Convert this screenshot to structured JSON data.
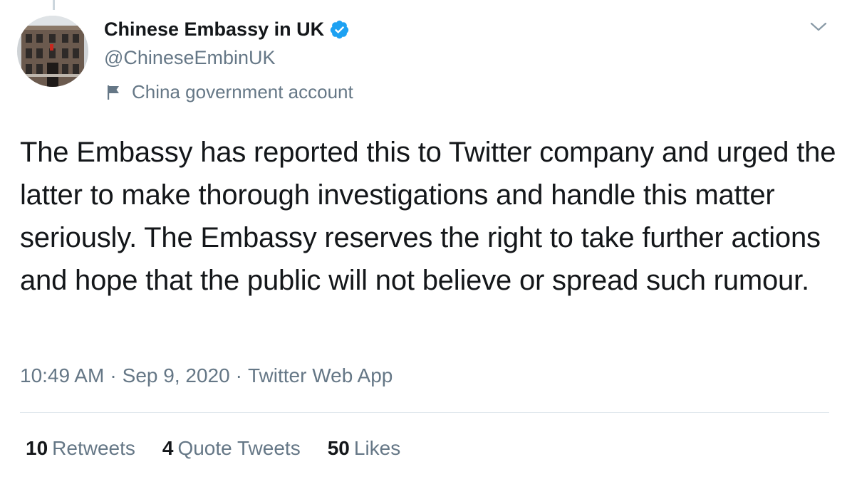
{
  "user": {
    "display_name": "Chinese Embassy in UK",
    "handle": "@ChineseEmbinUK",
    "verified": true,
    "label": "China government account",
    "avatar_icon": "embassy-building-photo"
  },
  "tweet": {
    "text": "The Embassy has reported this to Twitter company and urged the latter to make thorough investigations and handle this matter seriously. The Embassy reserves the right to take further actions and hope that the public will not believe or spread such rumour.",
    "time": "10:49 AM",
    "date": "Sep 9, 2020",
    "source": "Twitter Web App",
    "separator": "·"
  },
  "stats": {
    "retweets": {
      "count": "10",
      "label": "Retweets"
    },
    "quote_tweets": {
      "count": "4",
      "label": "Quote Tweets"
    },
    "likes": {
      "count": "50",
      "label": "Likes"
    }
  },
  "colors": {
    "primary_text": "#14171a",
    "secondary_text": "#657786",
    "verified_blue": "#1da1f2",
    "divider": "#e1e8ed"
  }
}
